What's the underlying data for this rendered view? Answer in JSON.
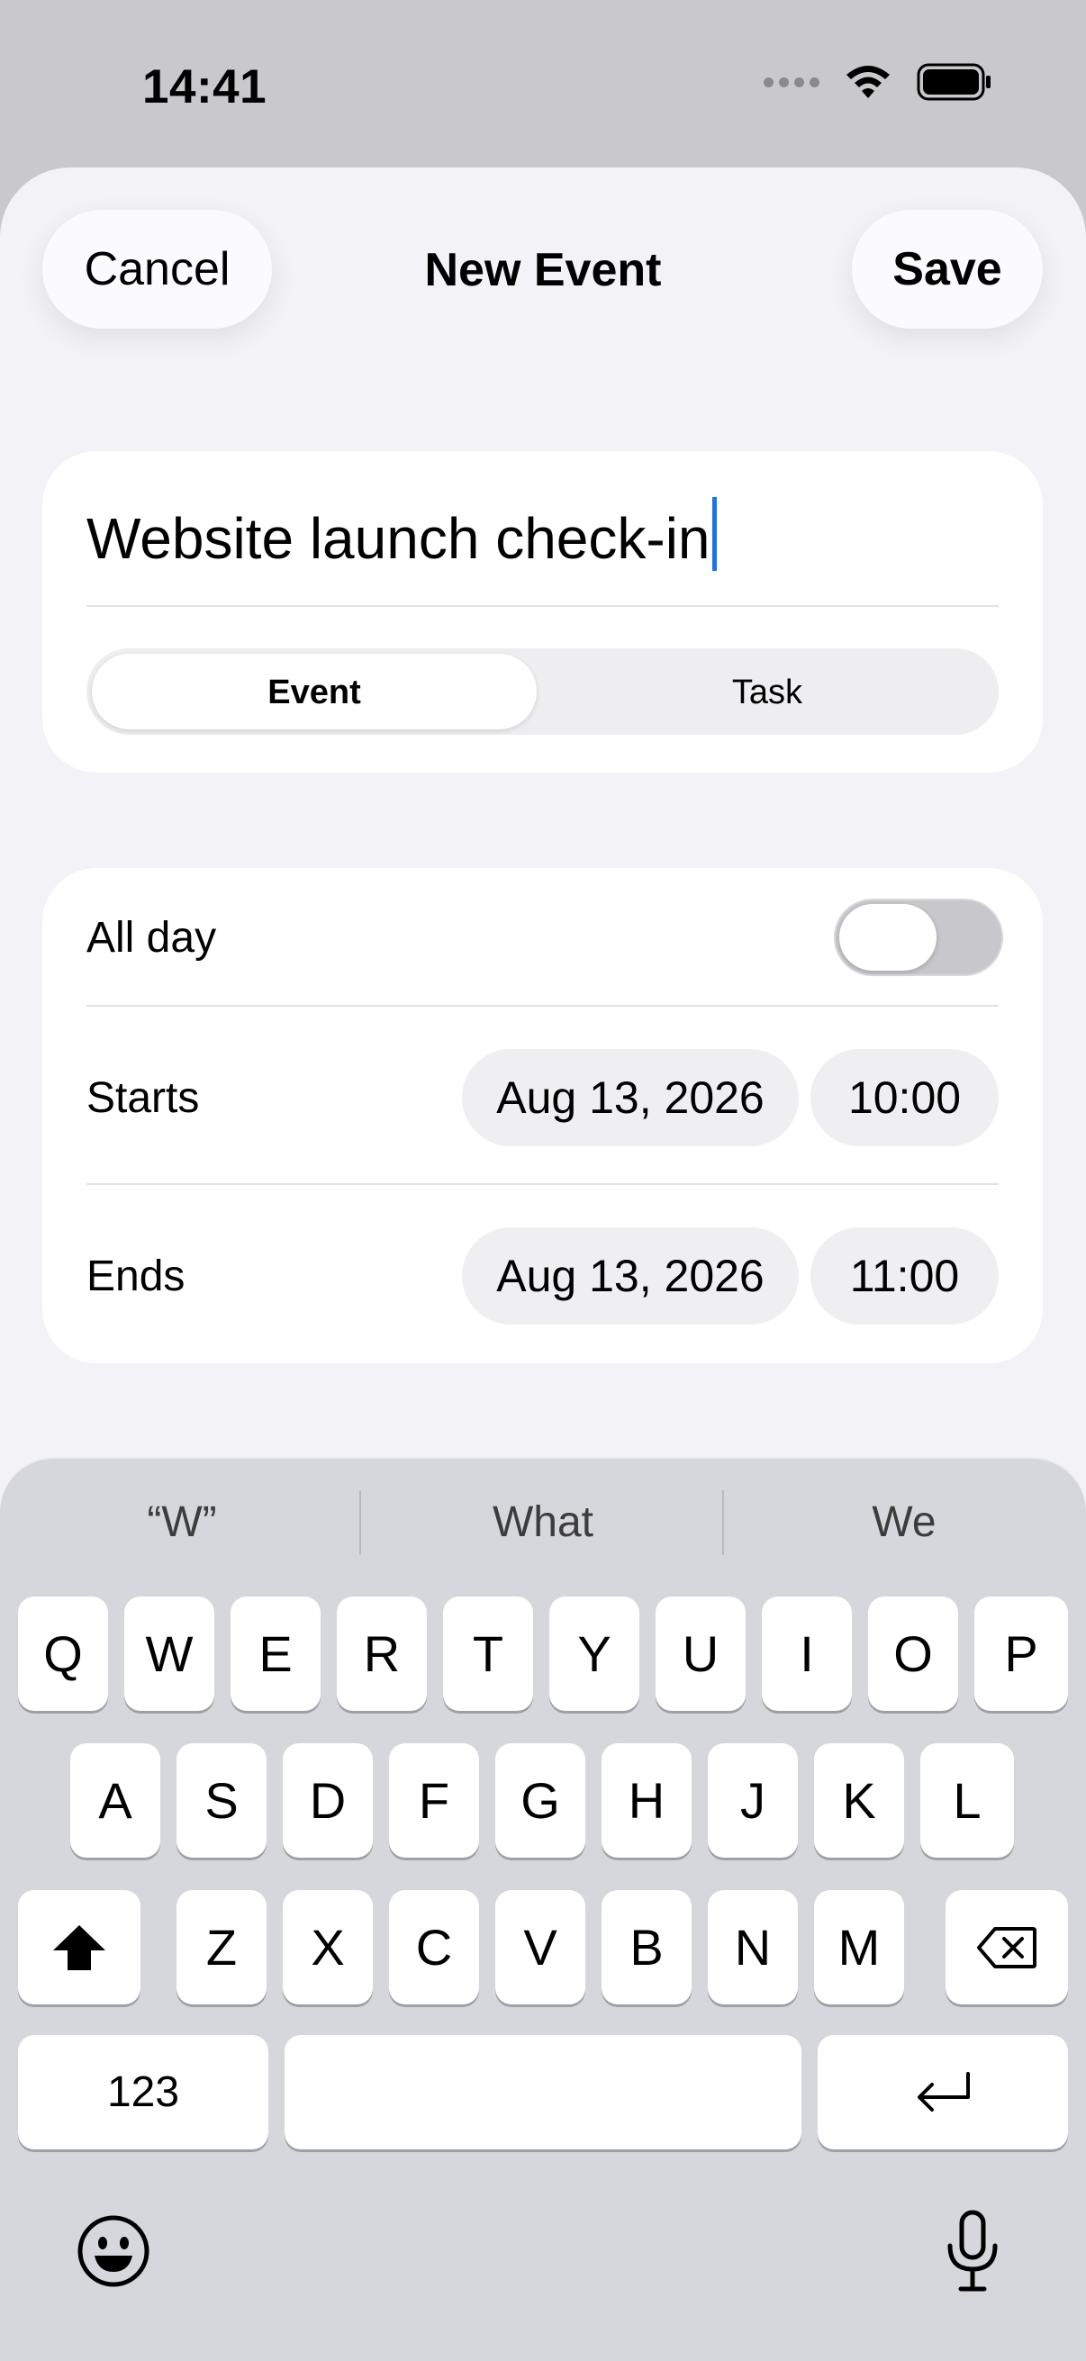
{
  "status_bar": {
    "time": "14:41"
  },
  "header": {
    "cancel_label": "Cancel",
    "title": "New Event",
    "save_label": "Save"
  },
  "title_field": {
    "value": "Website launch check-in"
  },
  "type_segment": {
    "options": [
      "Event",
      "Task"
    ],
    "selected": "Event"
  },
  "all_day": {
    "label": "All day",
    "on": false
  },
  "starts": {
    "label": "Starts",
    "date": "Aug 13, 2026",
    "time": "10:00"
  },
  "ends": {
    "label": "Ends",
    "date": "Aug 13, 2026",
    "time": "11:00"
  },
  "keyboard": {
    "suggestions": [
      "“W”",
      "What",
      "We"
    ],
    "row1": [
      "Q",
      "W",
      "E",
      "R",
      "T",
      "Y",
      "U",
      "I",
      "O",
      "P"
    ],
    "row2": [
      "A",
      "S",
      "D",
      "F",
      "G",
      "H",
      "J",
      "K",
      "L"
    ],
    "row3": [
      "Z",
      "X",
      "C",
      "V",
      "B",
      "N",
      "M"
    ],
    "numbers_label": "123",
    "icons": {
      "shift": "shift-icon",
      "delete": "delete-icon",
      "return": "return-icon",
      "emoji": "emoji-icon",
      "mic": "microphone-icon"
    }
  }
}
